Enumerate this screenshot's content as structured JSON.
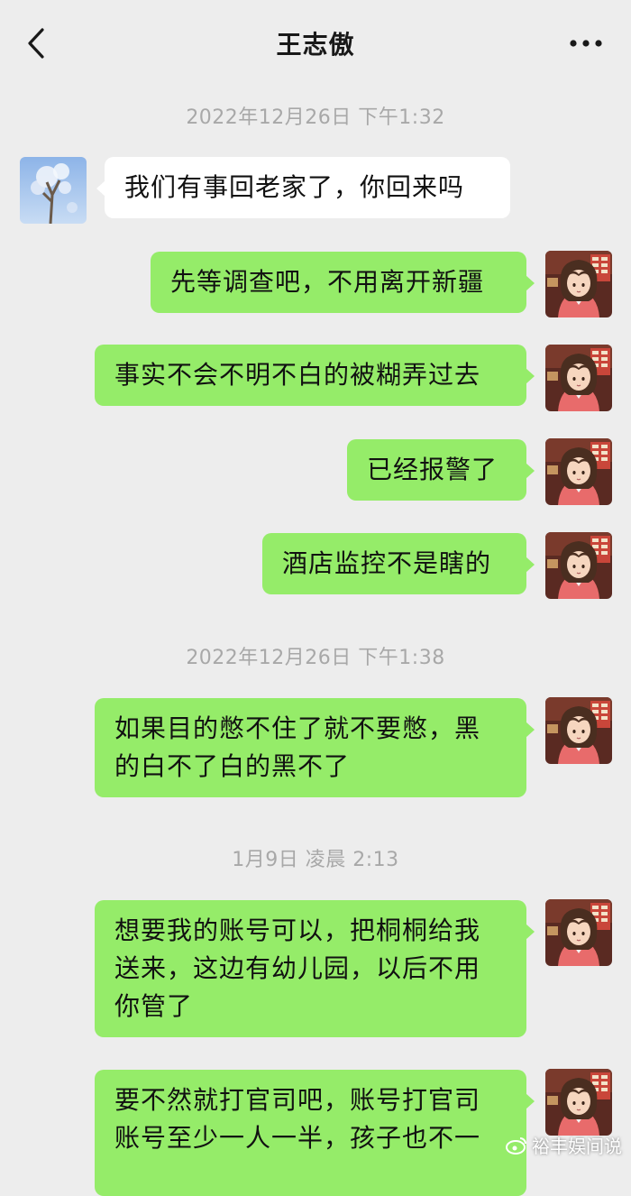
{
  "header": {
    "title": "王志傲",
    "back_icon": "chevron-left-icon",
    "more_icon": "more-dots-icon"
  },
  "colors": {
    "background": "#ededed",
    "incoming_bubble": "#ffffff",
    "outgoing_bubble": "#95ec69",
    "timestamp_text": "#a8a8a8"
  },
  "timestamps": [
    "2022年12月26日 下午1:32",
    "2022年12月26日 下午1:38",
    "1月9日 凌晨 2:13"
  ],
  "messages": [
    {
      "direction": "incoming",
      "text": "我们有事回老家了，你回来吗"
    },
    {
      "direction": "outgoing",
      "text": "先等调查吧，不用离开新疆"
    },
    {
      "direction": "outgoing",
      "text": "事实不会不明不白的被糊弄过去"
    },
    {
      "direction": "outgoing",
      "text": "已经报警了"
    },
    {
      "direction": "outgoing",
      "text": "酒店监控不是瞎的"
    },
    {
      "direction": "outgoing",
      "lines": [
        "如果目的憋不住了就不要憋，黑",
        "的白不了白的黑不了"
      ]
    },
    {
      "direction": "outgoing",
      "lines": [
        "想要我的账号可以，把桐桐给我",
        "送来，这边有幼儿园，以后不用",
        "你管了"
      ]
    },
    {
      "direction": "outgoing",
      "lines": [
        "要不然就打官司吧，账号打官司",
        "账号至少一人一半，孩子也不一"
      ]
    }
  ],
  "watermark": {
    "text": "裕丰娱间说",
    "icon": "weibo-logo-icon"
  }
}
